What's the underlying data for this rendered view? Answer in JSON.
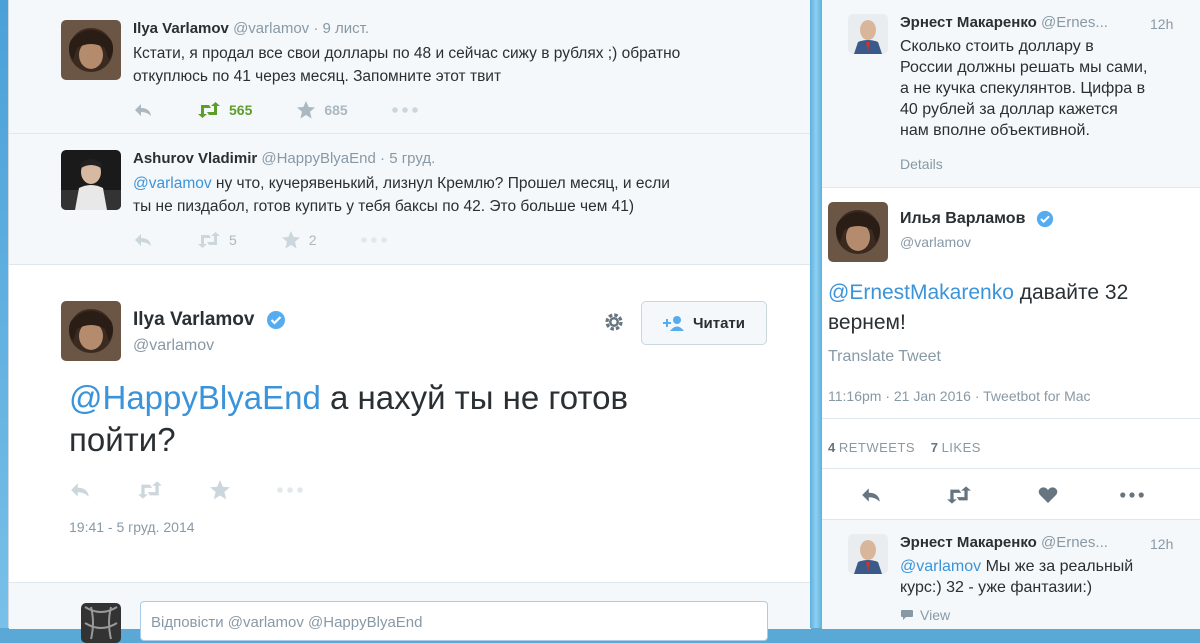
{
  "left": {
    "tweet1": {
      "name": "Ilya Varlamov",
      "handle": "@varlamov",
      "sep": "·",
      "date": "9 лист.",
      "text_line1": "Кстати, я продал все свои доллары по 48 и сейчас сижу в рублях ;) обратно",
      "text_line2": "откуплюсь по 41 через месяц. Запомните этот твит",
      "retweets": "565",
      "favorites": "685"
    },
    "tweet2": {
      "name": "Ashurov Vladimir",
      "handle": "@HappyBlyaEnd",
      "sep": "·",
      "date": "5 груд.",
      "mention": "@varlamov",
      "text_line1": " ну что, кучерявенький, лизнул Кремлю? Прошел месяц, и если",
      "text_line2": "ты не пиздабол, готов купить у тебя баксы по 42. Это больше чем 41)",
      "retweets": "5",
      "favorites": "2"
    },
    "main": {
      "name": "Ilya Varlamov",
      "handle": "@varlamov",
      "follow_label": "Читати",
      "mention": "@HappyBlyaEnd",
      "text_line1": " а нахуй ты не готов",
      "text_line2": "пойти?",
      "timestamp": "19:41 - 5 груд. 2014"
    },
    "reply": {
      "placeholder": "Відповісти @varlamov @HappyBlyaEnd"
    }
  },
  "right": {
    "top": {
      "name": "Эрнест Макаренко",
      "handle": "@Ernes...",
      "time": "12h",
      "lines": [
        "Сколько стоить доллару в",
        "России должны решать мы сами,",
        "а не кучка спекулянтов. Цифра в",
        "40 рублей за доллар кажется",
        "нам вполне объективной."
      ],
      "details": "Details"
    },
    "main": {
      "name": "Илья Варламов",
      "handle": "@varlamov",
      "mention": "@ErnestMakarenko",
      "text_rest": " давайте 32",
      "text_line2": "вернем!",
      "translate": "Translate Tweet",
      "meta": "11:16pm · 21 Jan 2016 · Tweetbot for Mac",
      "retweets_count": "4",
      "retweets_label": "RETWEETS",
      "likes_count": "7",
      "likes_label": "LIKES"
    },
    "reply": {
      "name": "Эрнест Макаренко",
      "handle": "@Ernes...",
      "time": "12h",
      "mention": "@varlamov",
      "text_line1": " Мы же за реальный",
      "text_line2": "курс:) 32 - уже фантазии:)",
      "view": "View"
    }
  },
  "colors": {
    "link": "#3b94d9",
    "muted": "#8899a6",
    "retweet_green": "#5d9d2a",
    "verified": "#55acee"
  }
}
